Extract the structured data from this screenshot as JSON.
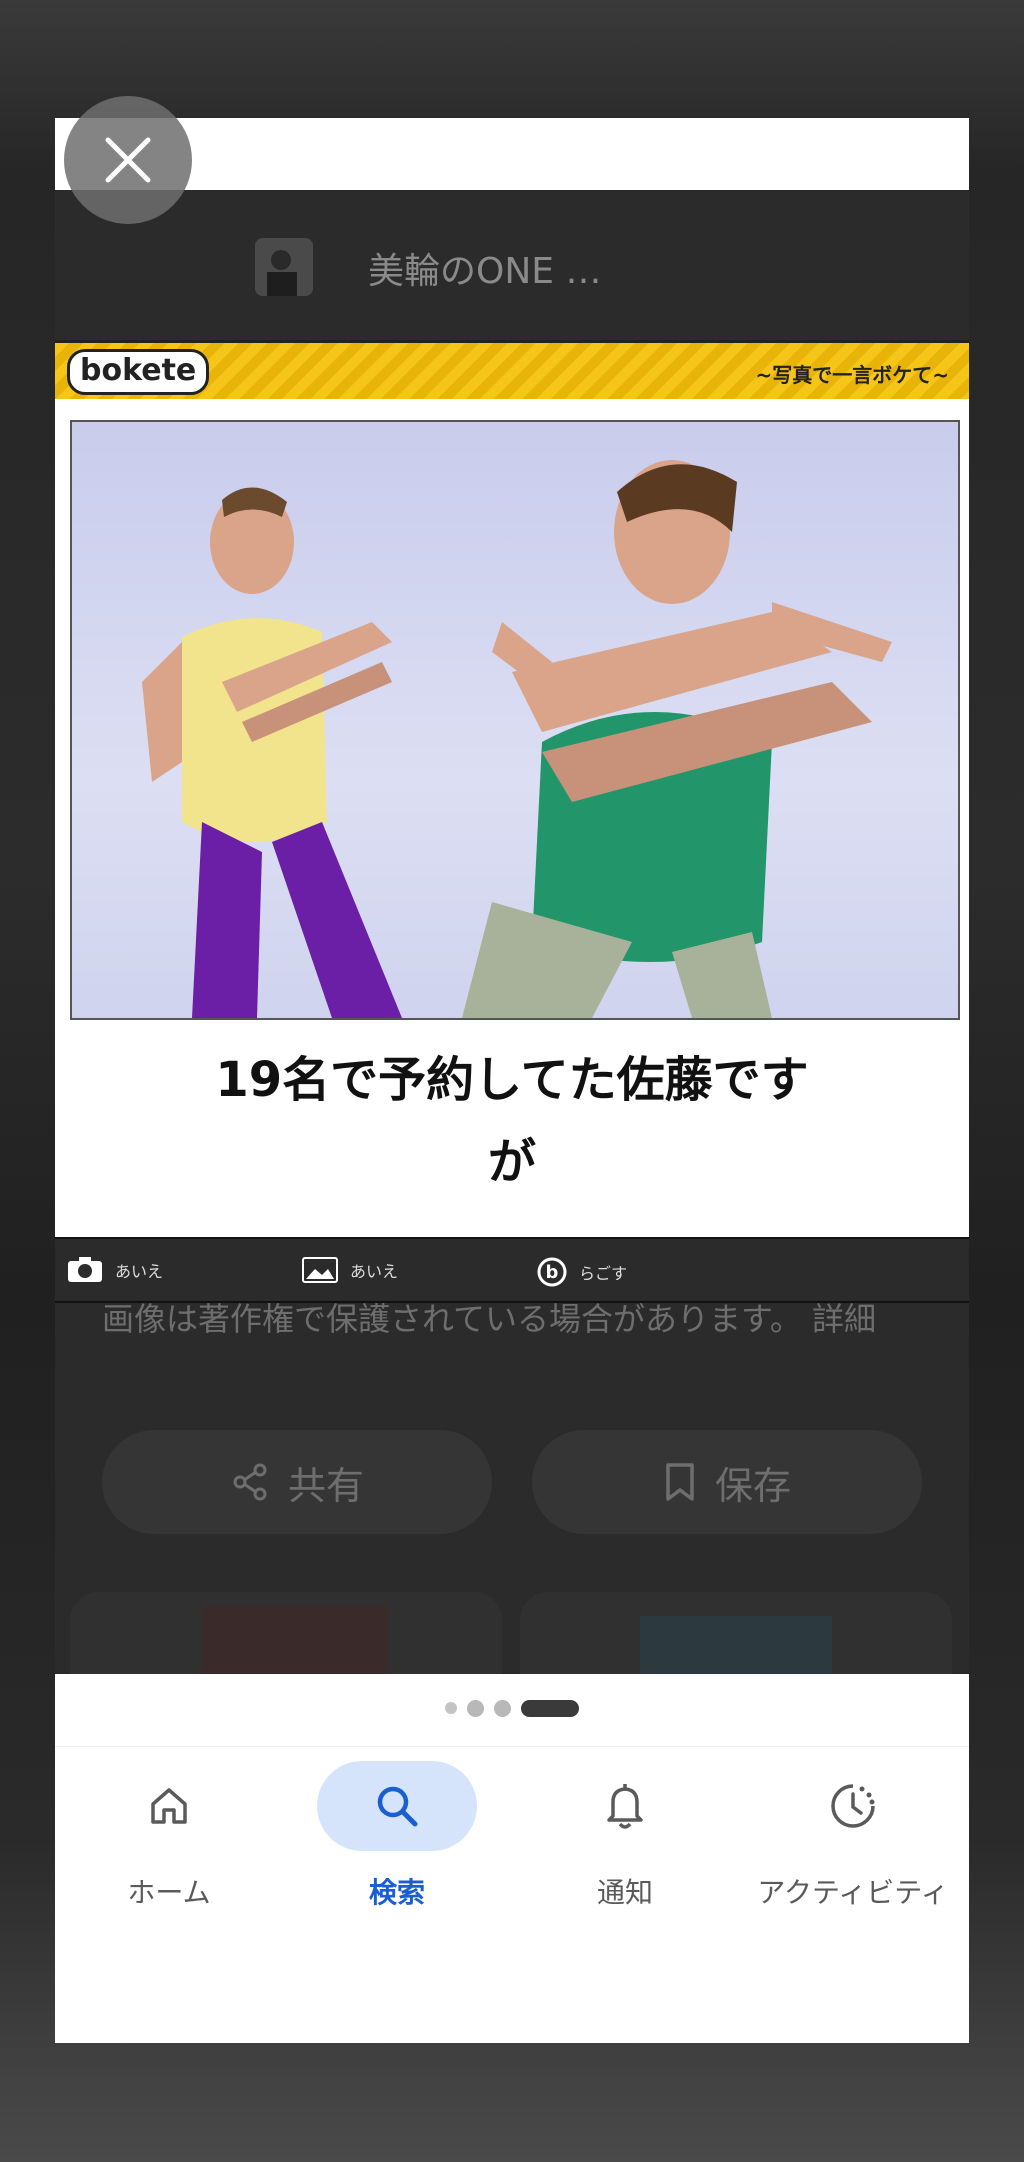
{
  "source": {
    "title": "美輪のONE …"
  },
  "meme": {
    "logo": "bokete",
    "tagline": "~写真で一言ボケて~",
    "caption_line1": "19名で予約してた佐藤です",
    "caption_line2": "が",
    "footer": [
      {
        "label": "あいえ"
      },
      {
        "label": "あいえ"
      },
      {
        "label": "らごす"
      }
    ]
  },
  "copyright_note": "画像は著作権で保護されている場合があります。 詳細",
  "actions": {
    "share_label": "共有",
    "save_label": "保存"
  },
  "pager": {
    "total": 4,
    "active_index": 3
  },
  "nav": {
    "items": [
      {
        "label": "ホーム",
        "icon": "home-icon"
      },
      {
        "label": "検索",
        "icon": "search-icon",
        "active": true
      },
      {
        "label": "通知",
        "icon": "bell-icon"
      },
      {
        "label": "アクティビティ",
        "icon": "activity-icon"
      }
    ]
  },
  "colors": {
    "accent": "#1a5fd1",
    "active_pill": "#d6e4fb",
    "meme_banner": "#f5c518"
  }
}
